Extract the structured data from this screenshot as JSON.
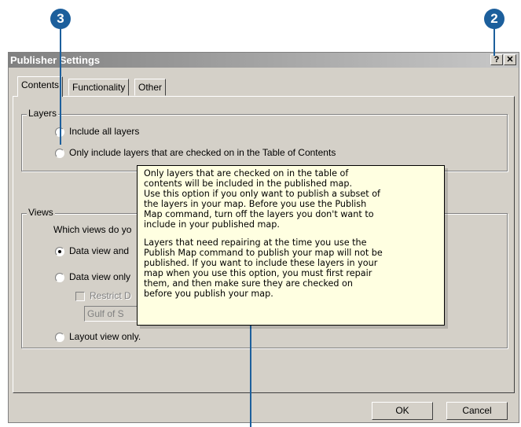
{
  "callouts": {
    "left": "3",
    "right": "2"
  },
  "dialog": {
    "title": "Publisher Settings",
    "help_button": "?",
    "close_button": "✕"
  },
  "tabs": [
    {
      "label": "Contents",
      "active": true
    },
    {
      "label": "Functionality",
      "active": false
    },
    {
      "label": "Other",
      "active": false
    }
  ],
  "layers": {
    "legend": "Layers",
    "options": [
      {
        "label": "Include all layers",
        "selected": false
      },
      {
        "label": "Only include layers that are checked on in the Table of Contents",
        "selected": false
      }
    ]
  },
  "views": {
    "legend": "Views",
    "prompt": "Which views do yo",
    "options": [
      {
        "label": "Data view and",
        "selected": true
      },
      {
        "label": "Data view only",
        "selected": false
      },
      {
        "label": "Layout view only.",
        "selected": false
      }
    ],
    "restrict_label": "Restrict D",
    "combo_value": "Gulf of S"
  },
  "tooltip": {
    "paragraph1": "Only layers that are checked on in the table of\ncontents will be included in the published map.\nUse this option if you only want to publish a subset of\nthe layers in your map. Before you use the Publish\nMap command, turn off the layers you don't want to\ninclude in your published map.",
    "paragraph2": "Layers that need repairing at the time you use the\nPublish Map command to publish your map will not be\npublished. If you want to include these layers in your\nmap when you use this option, you must first repair\nthem, and then make sure they are checked on\nbefore you publish your map."
  },
  "buttons": {
    "ok": "OK",
    "cancel": "Cancel"
  },
  "colors": {
    "callout": "#1c5f9c",
    "dialog_face": "#d4d0c8",
    "tooltip_bg": "#ffffe1"
  }
}
